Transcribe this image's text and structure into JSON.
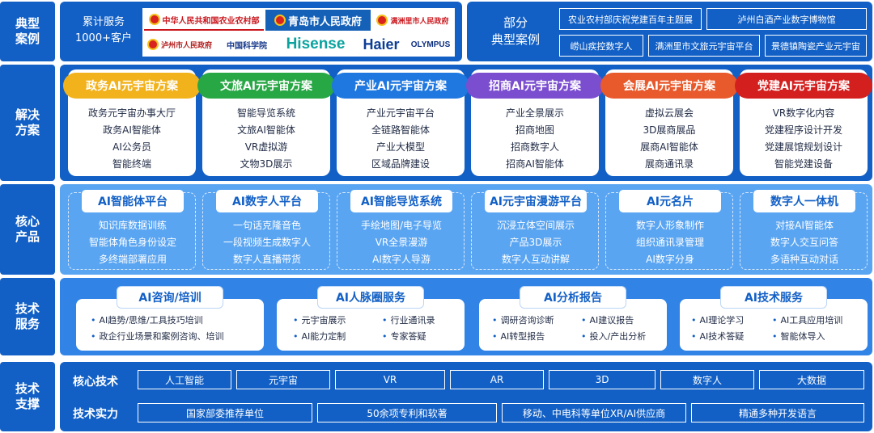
{
  "rows": {
    "cases": "典型案例",
    "solutions": "解决方案",
    "products": "核心产品",
    "services": "技术服务",
    "support": "技术支撑"
  },
  "cases": {
    "cumulative_line1": "累计服务",
    "cumulative_line2": "1000+客户",
    "logos": [
      "中华人民共和国农业农村部",
      "青岛市人民政府",
      "满洲里市人民政府",
      "泸州市人民政府",
      "中国科学院",
      "Hisense",
      "Haier",
      "OLYMPUS"
    ],
    "title_line1": "部分",
    "title_line2": "典型案例",
    "items": [
      "农业农村部庆祝党建百年主题展",
      "泸州白酒产业数字博物馆",
      "崂山疾控数字人",
      "满洲里市文旅元宇宙平台",
      "景德镇陶瓷产业元宇宙"
    ]
  },
  "solutions": [
    {
      "title": "政务AI元宇宙方案",
      "color": "#f2b21c",
      "items": [
        "政务元宇宙办事大厅",
        "政务AI智能体",
        "AI公务员",
        "智能终端"
      ]
    },
    {
      "title": "文旅AI元宇宙方案",
      "color": "#28a745",
      "items": [
        "智能导览系统",
        "文旅AI智能体",
        "VR虚拟游",
        "文物3D展示"
      ]
    },
    {
      "title": "产业AI元宇宙方案",
      "color": "#1f78e0",
      "items": [
        "产业元宇宙平台",
        "全链路智能体",
        "产业大模型",
        "区域品牌建设"
      ]
    },
    {
      "title": "招商AI元宇宙方案",
      "color": "#7b4ed0",
      "items": [
        "产业全景展示",
        "招商地图",
        "招商数字人",
        "招商AI智能体"
      ]
    },
    {
      "title": "会展AI元宇宙方案",
      "color": "#e85a2c",
      "items": [
        "虚拟云展会",
        "3D展商展品",
        "展商AI智能体",
        "展商通讯录"
      ]
    },
    {
      "title": "党建AI元宇宙方案",
      "color": "#d41f1f",
      "items": [
        "VR数字化内容",
        "党建程序设计开发",
        "党建展馆规划设计",
        "智能党建设备"
      ]
    }
  ],
  "products": [
    {
      "title": "AI智能体平台",
      "items": [
        "知识库数据训练",
        "智能体角色身份设定",
        "多终端部署应用"
      ]
    },
    {
      "title": "AI数字人平台",
      "items": [
        "一句话克隆音色",
        "一段视频生成数字人",
        "数字人直播带货"
      ]
    },
    {
      "title": "AI智能导览系统",
      "items": [
        "手绘地图/电子导览",
        "VR全景漫游",
        "AI数字人导游"
      ]
    },
    {
      "title": "AI元宇宙漫游平台",
      "items": [
        "沉浸立体空间展示",
        "产品3D展示",
        "数字人互动讲解"
      ]
    },
    {
      "title": "AI元名片",
      "items": [
        "数字人形象制作",
        "组织通讯录管理",
        "AI数字分身"
      ]
    },
    {
      "title": "数字人一体机",
      "items": [
        "对接AI智能体",
        "数字人交互问答",
        "多语种互动对话"
      ]
    }
  ],
  "services": [
    {
      "title": "AI咨询/培训",
      "items": [
        "AI趋势/思维/工具技巧培训",
        "政企行业场景和案例咨询、培训"
      ]
    },
    {
      "title": "AI人脉圈服务",
      "items": [
        "元宇宙展示",
        "行业通讯录",
        "AI能力定制",
        "专家答疑"
      ]
    },
    {
      "title": "AI分析报告",
      "items": [
        "调研咨询诊断",
        "AI建议报告",
        "AI转型报告",
        "投入/产出分析"
      ]
    },
    {
      "title": "AI技术服务",
      "items": [
        "AI理论学习",
        "AI工具应用培训",
        "AI技术答疑",
        "智能体导入"
      ]
    }
  ],
  "support": {
    "core_label": "核心技术",
    "core_items": [
      "人工智能",
      "元宇宙",
      "VR",
      "AR",
      "3D",
      "数字人",
      "大数据"
    ],
    "strength_label": "技术实力",
    "strength_items": [
      "国家部委推荐单位",
      "50余项专利和软著",
      "移动、中电科等单位XR/AI供应商",
      "精通多种开发语言"
    ]
  }
}
